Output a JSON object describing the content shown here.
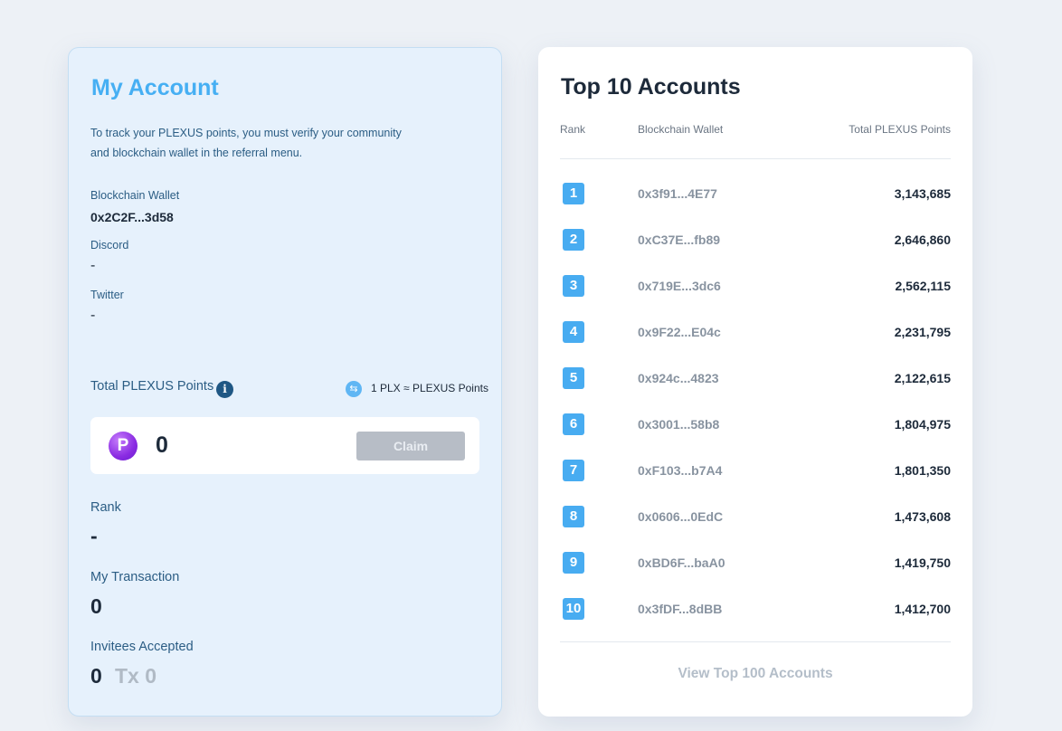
{
  "account": {
    "title": "My Account",
    "description": "To track your PLEXUS points, you must verify your community and blockchain wallet in the referral menu.",
    "wallet_label": "Blockchain Wallet",
    "wallet_value": "0x2C2F...3d58",
    "discord_label": "Discord",
    "discord_value": "-",
    "twitter_label": "Twitter",
    "twitter_value": "-",
    "points_label": "Total PLEXUS Points",
    "info_icon": "i",
    "rate_text": "1 PLX ≈ PLEXUS Points",
    "logo_letter": "P",
    "points_value": "0",
    "claim_label": "Claim",
    "rank_label": "Rank",
    "rank_value": "-",
    "transaction_label": "My Transaction",
    "transaction_value": "0",
    "invitees_label": "Invitees Accepted",
    "invitees_value": "0",
    "invitees_tx": "Tx 0"
  },
  "top": {
    "title": "Top 10 Accounts",
    "col_rank": "Rank",
    "col_wallet": "Blockchain Wallet",
    "col_points": "Total PLEXUS Points",
    "rows": [
      {
        "rank": "1",
        "wallet": "0x3f91...4E77",
        "points": "3,143,685"
      },
      {
        "rank": "2",
        "wallet": "0xC37E...fb89",
        "points": "2,646,860"
      },
      {
        "rank": "3",
        "wallet": "0x719E...3dc6",
        "points": "2,562,115"
      },
      {
        "rank": "4",
        "wallet": "0x9F22...E04c",
        "points": "2,231,795"
      },
      {
        "rank": "5",
        "wallet": "0x924c...4823",
        "points": "2,122,615"
      },
      {
        "rank": "6",
        "wallet": "0x3001...58b8",
        "points": "1,804,975"
      },
      {
        "rank": "7",
        "wallet": "0xF103...b7A4",
        "points": "1,801,350"
      },
      {
        "rank": "8",
        "wallet": "0x0606...0EdC",
        "points": "1,473,608"
      },
      {
        "rank": "9",
        "wallet": "0xBD6F...baA0",
        "points": "1,419,750"
      },
      {
        "rank": "10",
        "wallet": "0x3fDF...8dBB",
        "points": "1,412,700"
      }
    ],
    "view_more": "View Top 100 Accounts"
  },
  "colors": {
    "accent": "#46aff3",
    "rank_badge": "#48acf1",
    "claim_disabled": "#b7bdc6"
  },
  "icons": {
    "info": "info-icon",
    "swap": "swap-icon",
    "logo": "plexus-logo-icon"
  }
}
